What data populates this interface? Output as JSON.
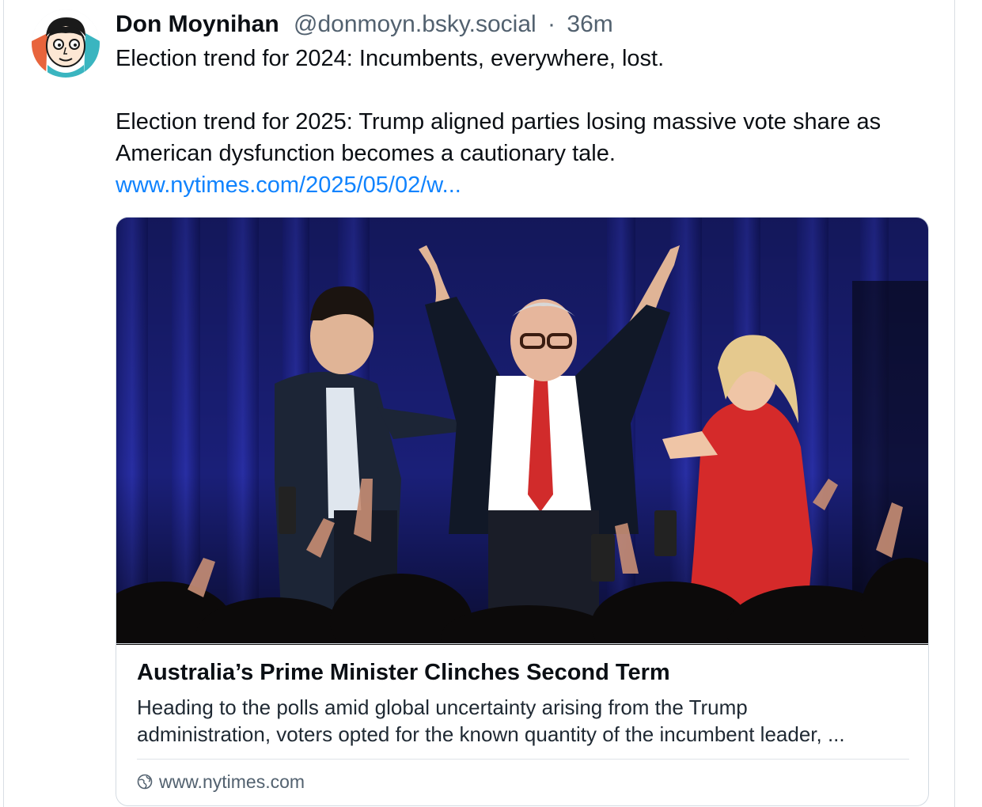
{
  "post": {
    "author_name": "Don Moynihan",
    "handle": "@donmoyn.bsky.social",
    "separator": "·",
    "age": "36m",
    "avatar_icon": "cartoon-face-avatar",
    "text_line_1": "Election trend for 2024: Incumbents, everywhere, lost.",
    "text_line_2": "Election trend for 2025: Trump aligned parties losing massive vote share as American dysfunction becomes a cautionary tale.",
    "link_text": "www.nytimes.com/2025/05/02/w..."
  },
  "card": {
    "image_icon": "celebration-photo",
    "title": "Australia’s Prime Minister Clinches Second Term",
    "desc_line_1": "Heading to the polls amid global uncertainty arising from the Trump",
    "desc_line_2": "administration, voters opted for the known quantity of the incumbent leader, ...",
    "domain": "www.nytimes.com",
    "domain_icon": "globe-icon"
  },
  "colors": {
    "link": "#1083fe",
    "muted": "#52616f",
    "text": "#0b0f14",
    "curtain": "#1a1f78"
  }
}
